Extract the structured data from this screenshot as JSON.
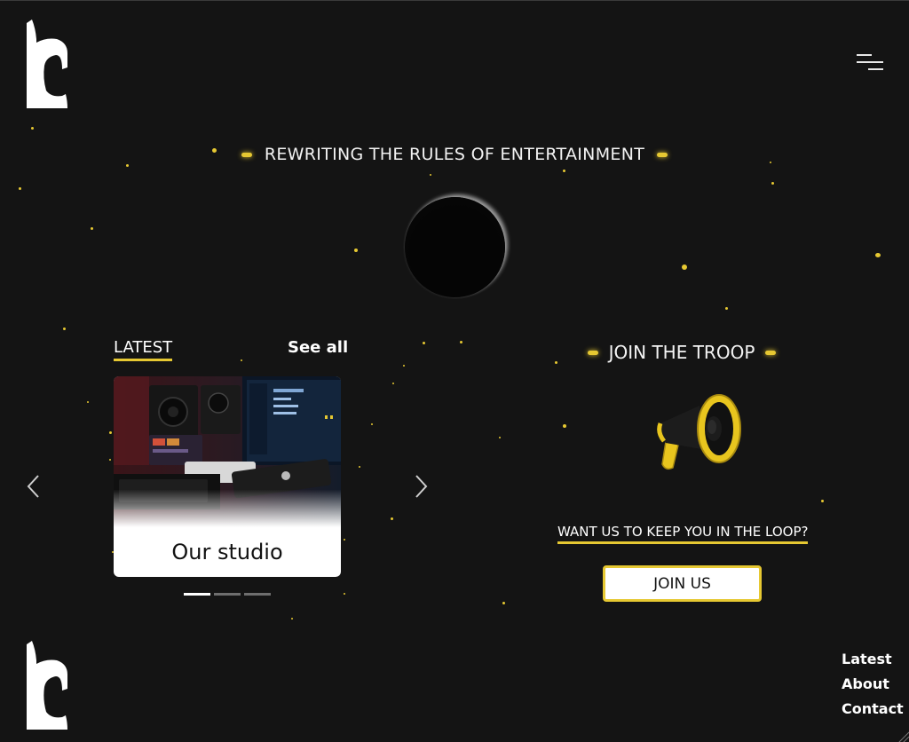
{
  "header": {
    "logo_icon": "logo-mark",
    "menu_icon": "hamburger-menu-icon"
  },
  "hero": {
    "tagline": "REWRITING THE RULES OF ENTERTAINMENT"
  },
  "latest": {
    "title": "LATEST",
    "see_all_label": "See all",
    "cards": [
      {
        "label": "Our studio",
        "image": "studio-photo"
      }
    ],
    "slide_count": 3,
    "active_slide": 0,
    "prev_icon": "chevron-left-icon",
    "next_icon": "chevron-right-icon"
  },
  "join": {
    "heading": "JOIN THE TROOP",
    "icon": "megaphone-icon",
    "prompt": "WANT US TO KEEP YOU IN THE LOOP?",
    "button_label": "JOIN US"
  },
  "footer": {
    "logo_icon": "logo-mark",
    "links": [
      "Latest",
      "About",
      "Contact"
    ]
  },
  "colors": {
    "background": "#141414",
    "accent": "#e6c832",
    "text": "#ffffff"
  }
}
